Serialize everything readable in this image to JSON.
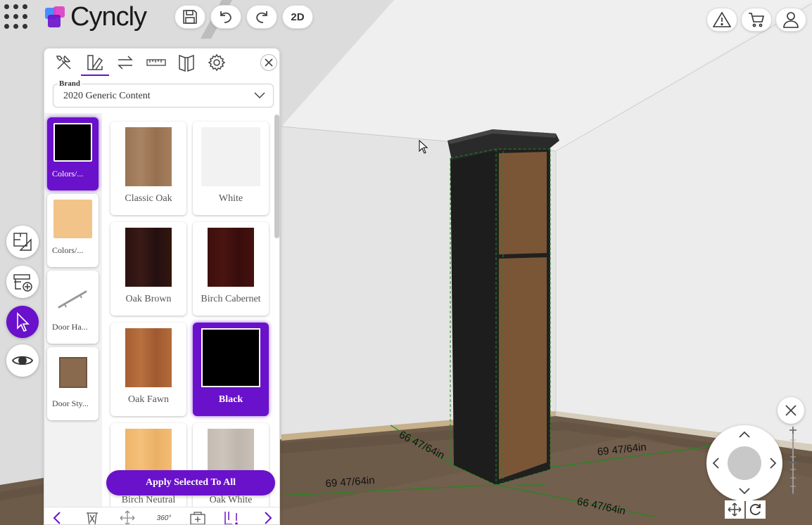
{
  "app": {
    "name": "Cyncly",
    "view_mode_label": "2D"
  },
  "colors": {
    "accent": "#6a11cb",
    "wall": "#f0f0f0",
    "floor": "#6b5a48",
    "dimension_line": "#1e8a1e"
  },
  "header": {
    "grid_menu_icon": "grid-menu-icon",
    "save_icon": "save-icon",
    "undo_icon": "undo-icon",
    "redo_icon": "redo-icon",
    "alert_icon": "warning-icon",
    "cart_icon": "cart-icon",
    "user_icon": "user-icon"
  },
  "left_dock": [
    {
      "icon": "floorplan-icon"
    },
    {
      "icon": "add-cabinet-icon"
    },
    {
      "icon": "select-cursor-icon",
      "active": true
    },
    {
      "icon": "eye-icon"
    }
  ],
  "panel": {
    "tabs": [
      "tools-icon",
      "materials-icon",
      "swap-icon",
      "ruler-icon",
      "door-icon",
      "settings-icon"
    ],
    "brand": {
      "label": "Brand",
      "value": "2020 Generic Content"
    },
    "categories": [
      {
        "label": "Colors/...",
        "swatch": "#000000",
        "active": true
      },
      {
        "label": "Colors/...",
        "swatch": "#f2c48a",
        "active": false
      },
      {
        "label": "Door Ha...",
        "swatch": "handle",
        "active": false
      },
      {
        "label": "Door Sty...",
        "swatch": "#8a6a4e",
        "active": false
      }
    ],
    "swatches": [
      {
        "label": "Classic Oak",
        "color": "#a07a5a",
        "selected": false
      },
      {
        "label": "White",
        "color": "#f2f2f2",
        "selected": false
      },
      {
        "label": "Oak Brown",
        "color": "#2a1210",
        "selected": false
      },
      {
        "label": "Birch Cabernet",
        "color": "#3d0f0d",
        "selected": false
      },
      {
        "label": "Oak Fawn",
        "color": "#b0673a",
        "selected": false
      },
      {
        "label": "Black",
        "color": "#000000",
        "selected": true
      },
      {
        "label": "Birch Neutral",
        "color": "#f0b86e",
        "selected": false
      },
      {
        "label": "Oak White",
        "color": "#c8c0b6",
        "selected": false
      }
    ],
    "apply_button": "Apply Selected To All",
    "footer_icons": [
      "prev-arrow-icon",
      "trash-icon",
      "move-icon",
      "view-360-icon",
      "duplicate-icon",
      "measure-alert-icon",
      "next-arrow-icon"
    ],
    "footer_360_label": "360°"
  },
  "scene": {
    "dimensions": [
      "66 47/64in",
      "69 47/64in",
      "69 47/64in",
      "66 47/64in"
    ]
  },
  "navigator": {
    "close_icon": "close-icon",
    "move_icon": "move-icon",
    "rotate_icon": "rotate-icon"
  }
}
